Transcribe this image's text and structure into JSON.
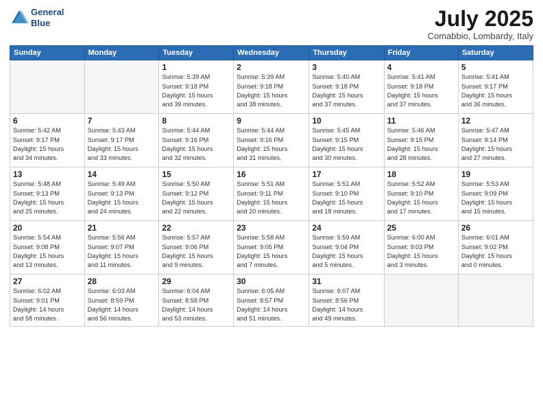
{
  "logo": {
    "line1": "General",
    "line2": "Blue"
  },
  "title": "July 2025",
  "location": "Comabbio, Lombardy, Italy",
  "header_days": [
    "Sunday",
    "Monday",
    "Tuesday",
    "Wednesday",
    "Thursday",
    "Friday",
    "Saturday"
  ],
  "weeks": [
    [
      {
        "day": "",
        "info": ""
      },
      {
        "day": "",
        "info": ""
      },
      {
        "day": "1",
        "info": "Sunrise: 5:39 AM\nSunset: 9:18 PM\nDaylight: 15 hours\nand 39 minutes."
      },
      {
        "day": "2",
        "info": "Sunrise: 5:39 AM\nSunset: 9:18 PM\nDaylight: 15 hours\nand 38 minutes."
      },
      {
        "day": "3",
        "info": "Sunrise: 5:40 AM\nSunset: 9:18 PM\nDaylight: 15 hours\nand 37 minutes."
      },
      {
        "day": "4",
        "info": "Sunrise: 5:41 AM\nSunset: 9:18 PM\nDaylight: 15 hours\nand 37 minutes."
      },
      {
        "day": "5",
        "info": "Sunrise: 5:41 AM\nSunset: 9:17 PM\nDaylight: 15 hours\nand 36 minutes."
      }
    ],
    [
      {
        "day": "6",
        "info": "Sunrise: 5:42 AM\nSunset: 9:17 PM\nDaylight: 15 hours\nand 34 minutes."
      },
      {
        "day": "7",
        "info": "Sunrise: 5:43 AM\nSunset: 9:17 PM\nDaylight: 15 hours\nand 33 minutes."
      },
      {
        "day": "8",
        "info": "Sunrise: 5:44 AM\nSunset: 9:16 PM\nDaylight: 15 hours\nand 32 minutes."
      },
      {
        "day": "9",
        "info": "Sunrise: 5:44 AM\nSunset: 9:16 PM\nDaylight: 15 hours\nand 31 minutes."
      },
      {
        "day": "10",
        "info": "Sunrise: 5:45 AM\nSunset: 9:15 PM\nDaylight: 15 hours\nand 30 minutes."
      },
      {
        "day": "11",
        "info": "Sunrise: 5:46 AM\nSunset: 9:15 PM\nDaylight: 15 hours\nand 28 minutes."
      },
      {
        "day": "12",
        "info": "Sunrise: 5:47 AM\nSunset: 9:14 PM\nDaylight: 15 hours\nand 27 minutes."
      }
    ],
    [
      {
        "day": "13",
        "info": "Sunrise: 5:48 AM\nSunset: 9:13 PM\nDaylight: 15 hours\nand 25 minutes."
      },
      {
        "day": "14",
        "info": "Sunrise: 5:49 AM\nSunset: 9:13 PM\nDaylight: 15 hours\nand 24 minutes."
      },
      {
        "day": "15",
        "info": "Sunrise: 5:50 AM\nSunset: 9:12 PM\nDaylight: 15 hours\nand 22 minutes."
      },
      {
        "day": "16",
        "info": "Sunrise: 5:51 AM\nSunset: 9:11 PM\nDaylight: 15 hours\nand 20 minutes."
      },
      {
        "day": "17",
        "info": "Sunrise: 5:51 AM\nSunset: 9:10 PM\nDaylight: 15 hours\nand 18 minutes."
      },
      {
        "day": "18",
        "info": "Sunrise: 5:52 AM\nSunset: 9:10 PM\nDaylight: 15 hours\nand 17 minutes."
      },
      {
        "day": "19",
        "info": "Sunrise: 5:53 AM\nSunset: 9:09 PM\nDaylight: 15 hours\nand 15 minutes."
      }
    ],
    [
      {
        "day": "20",
        "info": "Sunrise: 5:54 AM\nSunset: 9:08 PM\nDaylight: 15 hours\nand 13 minutes."
      },
      {
        "day": "21",
        "info": "Sunrise: 5:56 AM\nSunset: 9:07 PM\nDaylight: 15 hours\nand 11 minutes."
      },
      {
        "day": "22",
        "info": "Sunrise: 5:57 AM\nSunset: 9:06 PM\nDaylight: 15 hours\nand 9 minutes."
      },
      {
        "day": "23",
        "info": "Sunrise: 5:58 AM\nSunset: 9:05 PM\nDaylight: 15 hours\nand 7 minutes."
      },
      {
        "day": "24",
        "info": "Sunrise: 5:59 AM\nSunset: 9:04 PM\nDaylight: 15 hours\nand 5 minutes."
      },
      {
        "day": "25",
        "info": "Sunrise: 6:00 AM\nSunset: 9:03 PM\nDaylight: 15 hours\nand 3 minutes."
      },
      {
        "day": "26",
        "info": "Sunrise: 6:01 AM\nSunset: 9:02 PM\nDaylight: 15 hours\nand 0 minutes."
      }
    ],
    [
      {
        "day": "27",
        "info": "Sunrise: 6:02 AM\nSunset: 9:01 PM\nDaylight: 14 hours\nand 58 minutes."
      },
      {
        "day": "28",
        "info": "Sunrise: 6:03 AM\nSunset: 8:59 PM\nDaylight: 14 hours\nand 56 minutes."
      },
      {
        "day": "29",
        "info": "Sunrise: 6:04 AM\nSunset: 8:58 PM\nDaylight: 14 hours\nand 53 minutes."
      },
      {
        "day": "30",
        "info": "Sunrise: 6:05 AM\nSunset: 8:57 PM\nDaylight: 14 hours\nand 51 minutes."
      },
      {
        "day": "31",
        "info": "Sunrise: 6:07 AM\nSunset: 8:56 PM\nDaylight: 14 hours\nand 49 minutes."
      },
      {
        "day": "",
        "info": ""
      },
      {
        "day": "",
        "info": ""
      }
    ]
  ]
}
